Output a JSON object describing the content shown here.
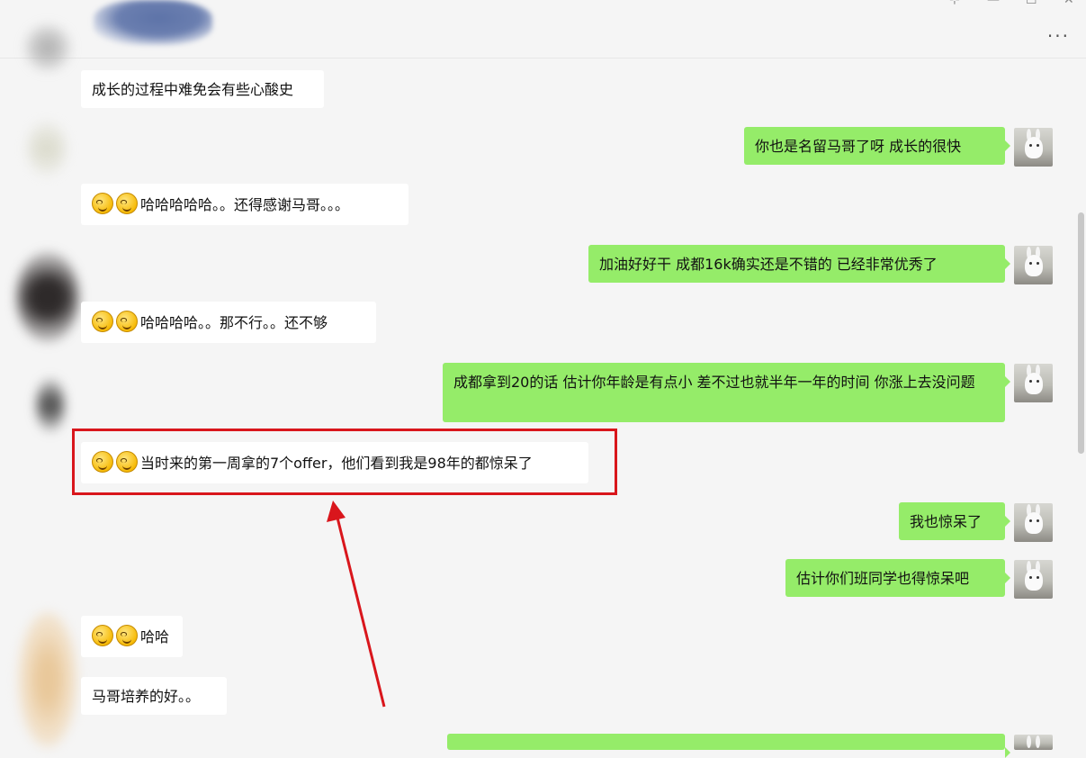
{
  "header": {
    "more_label": "···",
    "window_controls": [
      "⊹",
      "—",
      "☐",
      "✕"
    ]
  },
  "messages": [
    {
      "side": "left",
      "text": "成长的过程中难免会有些心酸史",
      "emoji_count": 0
    },
    {
      "side": "right",
      "text": "你也是名留马哥了呀  成长的很快"
    },
    {
      "side": "left",
      "text": "哈哈哈哈哈。。还得感谢马哥。。。",
      "emoji_count": 2
    },
    {
      "side": "right",
      "text": "加油好好干  成都16k确实还是不错的   已经非常优秀了"
    },
    {
      "side": "left",
      "text": "哈哈哈哈。。那不行。。还不够",
      "emoji_count": 2
    },
    {
      "side": "right",
      "text": "成都拿到20的话  估计你年龄是有点小   差不过也就半年一年的时间  你涨上去没问题"
    },
    {
      "side": "left",
      "text": "当时来的第一周拿的7个offer，他们看到我是98年的都惊呆了",
      "emoji_count": 2,
      "highlighted": true
    },
    {
      "side": "right",
      "text": "我也惊呆了"
    },
    {
      "side": "right",
      "text": "估计你们班同学也得惊呆吧"
    },
    {
      "side": "left",
      "text": "哈哈",
      "emoji_count": 2
    },
    {
      "side": "left",
      "text": "马哥培养的好。。",
      "emoji_count": 0
    }
  ],
  "annotation": {
    "color": "#d9161c"
  },
  "colors": {
    "right_bubble": "#95ec69",
    "left_bubble": "#ffffff",
    "background": "#f5f5f5"
  }
}
